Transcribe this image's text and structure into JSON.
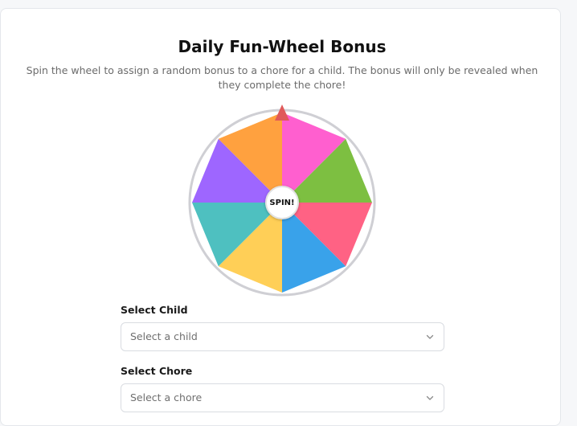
{
  "card": {
    "title": "Daily Fun-Wheel Bonus",
    "subtitle": "Spin the wheel to assign a random bonus to a chore for a child. The bonus will only be revealed when they complete the chore!"
  },
  "wheel": {
    "spin_label": "SPIN!",
    "pointer_color": "#e05a5a",
    "segments": [
      {
        "color": "#ff5fcf"
      },
      {
        "color": "#7dbf41"
      },
      {
        "color": "#ff6284"
      },
      {
        "color": "#39a2ea"
      },
      {
        "color": "#ffcf57"
      },
      {
        "color": "#4ec0c0"
      },
      {
        "color": "#9e66ff"
      },
      {
        "color": "#ffa13f"
      }
    ]
  },
  "form": {
    "child_label": "Select Child",
    "child_placeholder": "Select a child",
    "chore_label": "Select Chore",
    "chore_placeholder": "Select a chore"
  }
}
